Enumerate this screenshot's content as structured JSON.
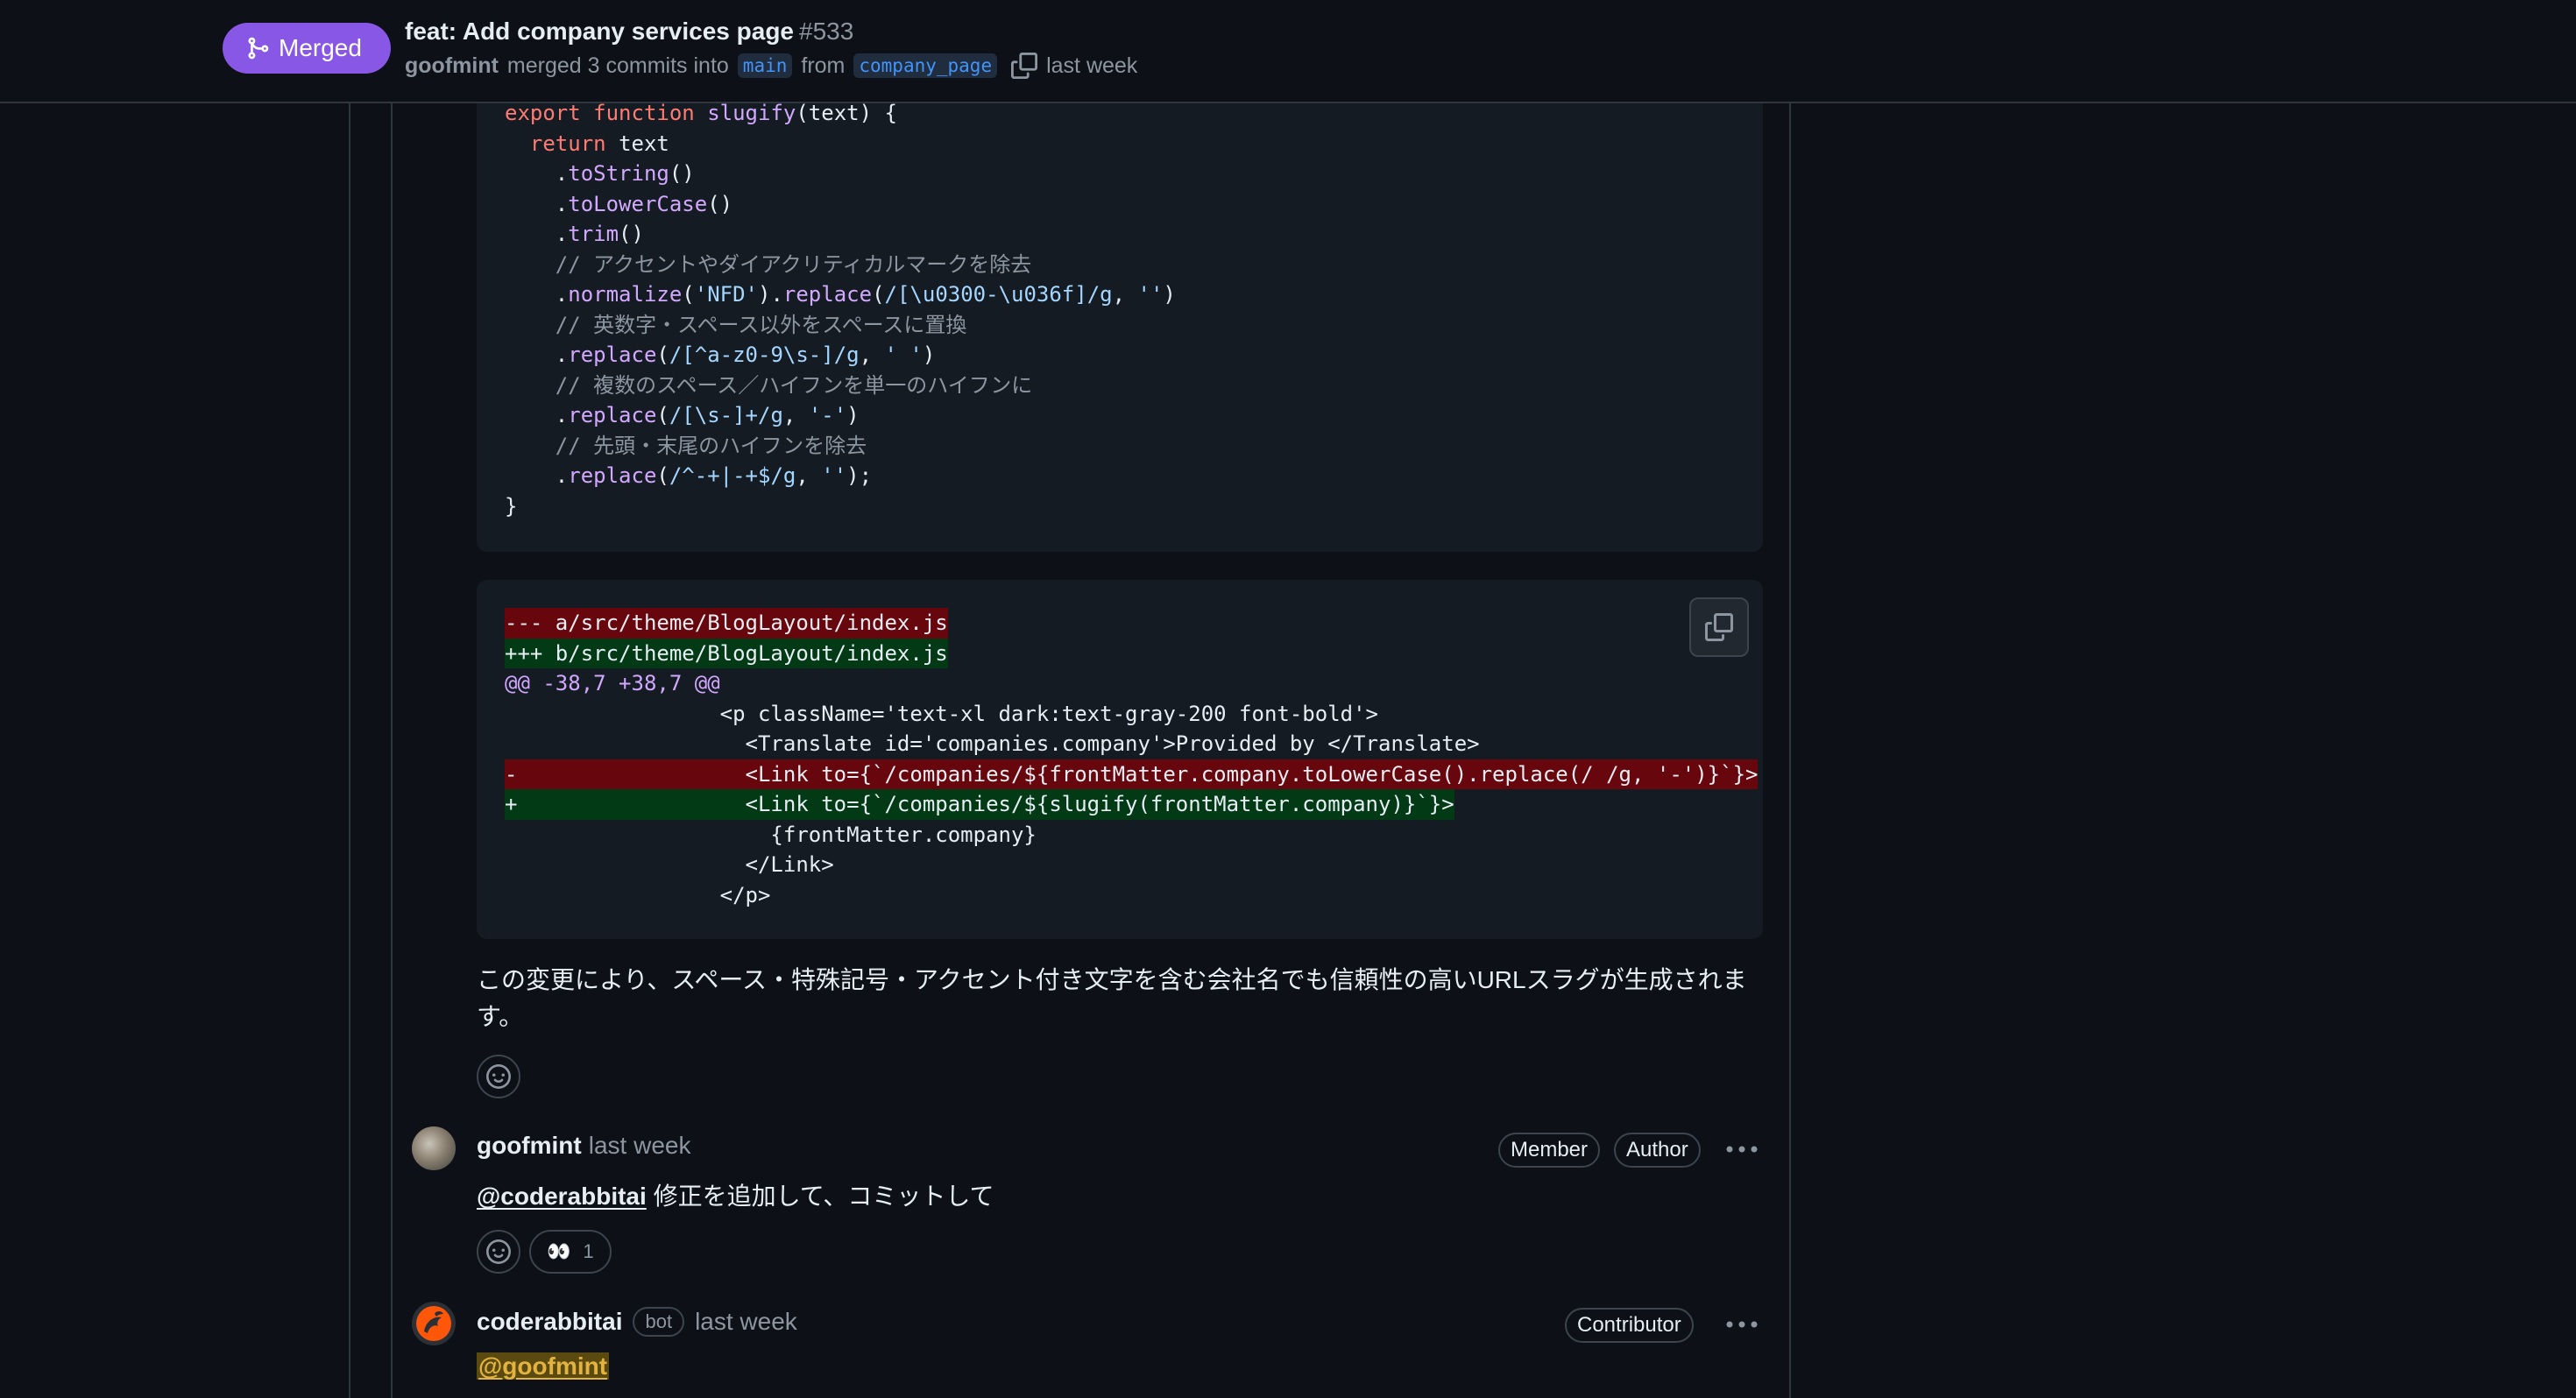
{
  "header": {
    "status": "Merged",
    "title": "feat: Add company services page",
    "number": "#533",
    "author": "goofmint",
    "merge_text": "merged 3 commits into",
    "base_branch": "main",
    "from_text": "from",
    "head_branch": "company_page",
    "time": "last week"
  },
  "code_block_1": {
    "lines": [
      [
        {
          "t": "export ",
          "c": "kw"
        },
        {
          "t": "function ",
          "c": "kw"
        },
        {
          "t": "slugify",
          "c": "fn"
        },
        {
          "t": "(text) {",
          "c": ""
        }
      ],
      [
        {
          "t": "  ",
          "c": ""
        },
        {
          "t": "return ",
          "c": "kw"
        },
        {
          "t": "text",
          "c": ""
        }
      ],
      [
        {
          "t": "    .",
          "c": ""
        },
        {
          "t": "toString",
          "c": "fn"
        },
        {
          "t": "()",
          "c": ""
        }
      ],
      [
        {
          "t": "    .",
          "c": ""
        },
        {
          "t": "toLowerCase",
          "c": "fn"
        },
        {
          "t": "()",
          "c": ""
        }
      ],
      [
        {
          "t": "    .",
          "c": ""
        },
        {
          "t": "trim",
          "c": "fn"
        },
        {
          "t": "()",
          "c": ""
        }
      ],
      [
        {
          "t": "    // アクセントやダイアクリティカルマークを除去",
          "c": "cm"
        }
      ],
      [
        {
          "t": "    .",
          "c": ""
        },
        {
          "t": "normalize",
          "c": "fn"
        },
        {
          "t": "(",
          "c": ""
        },
        {
          "t": "'NFD'",
          "c": "str"
        },
        {
          "t": ").",
          "c": ""
        },
        {
          "t": "replace",
          "c": "fn"
        },
        {
          "t": "(",
          "c": ""
        },
        {
          "t": "/[\\u0300-\\u036f]/g",
          "c": "str"
        },
        {
          "t": ", ",
          "c": ""
        },
        {
          "t": "''",
          "c": "str"
        },
        {
          "t": ")",
          "c": ""
        }
      ],
      [
        {
          "t": "    // 英数字・スペース以外をスペースに置換",
          "c": "cm"
        }
      ],
      [
        {
          "t": "    .",
          "c": ""
        },
        {
          "t": "replace",
          "c": "fn"
        },
        {
          "t": "(",
          "c": ""
        },
        {
          "t": "/[^a-z0-9\\s-]/g",
          "c": "str"
        },
        {
          "t": ", ",
          "c": ""
        },
        {
          "t": "' '",
          "c": "str"
        },
        {
          "t": ")",
          "c": ""
        }
      ],
      [
        {
          "t": "    // 複数のスペース／ハイフンを単一のハイフンに",
          "c": "cm"
        }
      ],
      [
        {
          "t": "    .",
          "c": ""
        },
        {
          "t": "replace",
          "c": "fn"
        },
        {
          "t": "(",
          "c": ""
        },
        {
          "t": "/[\\s-]+/g",
          "c": "str"
        },
        {
          "t": ", ",
          "c": ""
        },
        {
          "t": "'-'",
          "c": "str"
        },
        {
          "t": ")",
          "c": ""
        }
      ],
      [
        {
          "t": "    // 先頭・末尾のハイフンを除去",
          "c": "cm"
        }
      ],
      [
        {
          "t": "    .",
          "c": ""
        },
        {
          "t": "replace",
          "c": "fn"
        },
        {
          "t": "(",
          "c": ""
        },
        {
          "t": "/^-+|-+$/g",
          "c": "str"
        },
        {
          "t": ", ",
          "c": ""
        },
        {
          "t": "''",
          "c": "str"
        },
        {
          "t": ");",
          "c": ""
        }
      ],
      [
        {
          "t": "}",
          "c": ""
        }
      ]
    ]
  },
  "code_block_2": {
    "lines": [
      [
        {
          "t": "--- a/src/theme/BlogLayout/index.js",
          "c": "del"
        }
      ],
      [
        {
          "t": "+++ b/src/theme/BlogLayout/index.js",
          "c": "add"
        }
      ],
      [
        {
          "t": "@@ -38,7 +38,7 @@",
          "c": "hunk"
        }
      ],
      [
        {
          "t": "                 <p className='text-xl dark:text-gray-200 font-bold'>",
          "c": ""
        }
      ],
      [
        {
          "t": "                   <Translate id='companies.company'>Provided by </Translate>",
          "c": ""
        }
      ],
      [
        {
          "t": "-                  <Link to={`/companies/${frontMatter.company.toLowerCase().replace(/ /g, '-')}`}>",
          "c": "del"
        }
      ],
      [
        {
          "t": "+                  <Link to={`/companies/${slugify(frontMatter.company)}`}>",
          "c": "add"
        }
      ],
      [
        {
          "t": "                     {frontMatter.company}",
          "c": ""
        }
      ],
      [
        {
          "t": "                   </Link>",
          "c": ""
        }
      ],
      [
        {
          "t": "                 </p>",
          "c": ""
        }
      ]
    ]
  },
  "prose": "この変更により、スペース・特殊記号・アクセント付き文字を含む会社名でも信頼性の高いURLスラグが生成されます。",
  "comment_1": {
    "author": "goofmint",
    "time": "last week",
    "badges": [
      "Member",
      "Author"
    ],
    "mention": "@coderabbitai",
    "text": " 修正を追加して、コミットして",
    "reaction_emoji": "👀",
    "reaction_count": "1"
  },
  "comment_2": {
    "author": "coderabbitai",
    "bot_label": "bot",
    "time": "last week",
    "badge": "Contributor",
    "mention": "@goofmint"
  },
  "colors": {
    "merged": "#8957e5",
    "background": "#0d1117",
    "code_bg": "#151b23",
    "diff_del": "#67060c",
    "diff_add": "#033a16"
  }
}
